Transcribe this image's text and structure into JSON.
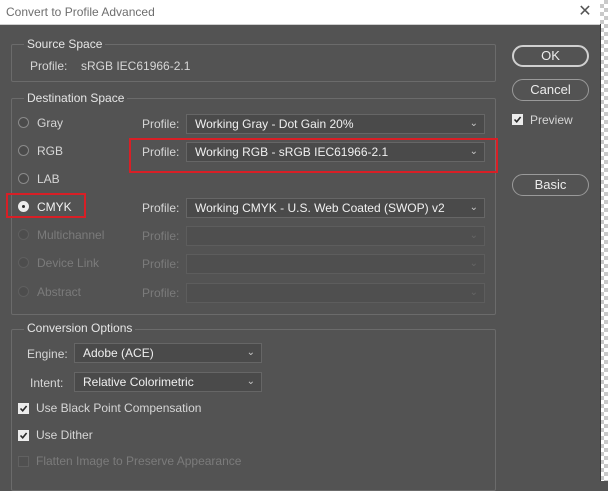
{
  "window": {
    "title": "Convert to Profile Advanced"
  },
  "source_space": {
    "legend": "Source Space",
    "label": "Profile:",
    "value": "sRGB IEC61966-2.1"
  },
  "destination_space": {
    "legend": "Destination Space",
    "profile_label": "Profile:",
    "rows": [
      {
        "mode": "Gray",
        "profile": "Working Gray - Dot Gain 20%",
        "selected": false,
        "enabled": true
      },
      {
        "mode": "RGB",
        "profile": "Working RGB - sRGB IEC61966-2.1",
        "selected": false,
        "enabled": true
      },
      {
        "mode": "LAB",
        "profile": "",
        "selected": false,
        "enabled": true
      },
      {
        "mode": "CMYK",
        "profile": "Working CMYK - U.S. Web Coated (SWOP) v2",
        "selected": true,
        "enabled": true
      },
      {
        "mode": "Multichannel",
        "profile": "",
        "selected": false,
        "enabled": false
      },
      {
        "mode": "Device Link",
        "profile": "",
        "selected": false,
        "enabled": false
      },
      {
        "mode": "Abstract",
        "profile": "",
        "selected": false,
        "enabled": false
      }
    ]
  },
  "conversion_options": {
    "legend": "Conversion Options",
    "engine_label": "Engine:",
    "engine_value": "Adobe (ACE)",
    "intent_label": "Intent:",
    "intent_value": "Relative Colorimetric",
    "black_point": {
      "label": "Use Black Point Compensation",
      "checked": true
    },
    "dither": {
      "label": "Use Dither",
      "checked": true
    },
    "flatten": {
      "label": "Flatten Image to Preserve Appearance",
      "checked": false,
      "enabled": false
    }
  },
  "buttons": {
    "ok": "OK",
    "cancel": "Cancel",
    "basic": "Basic"
  },
  "preview": {
    "label": "Preview",
    "checked": true
  },
  "colors": {
    "background": "#535353",
    "highlight": "#d81f26",
    "titlebar": "#ffffff"
  },
  "icons": {
    "close": "close-icon",
    "dropdown": "chevron-down-icon",
    "check": "check-icon"
  }
}
